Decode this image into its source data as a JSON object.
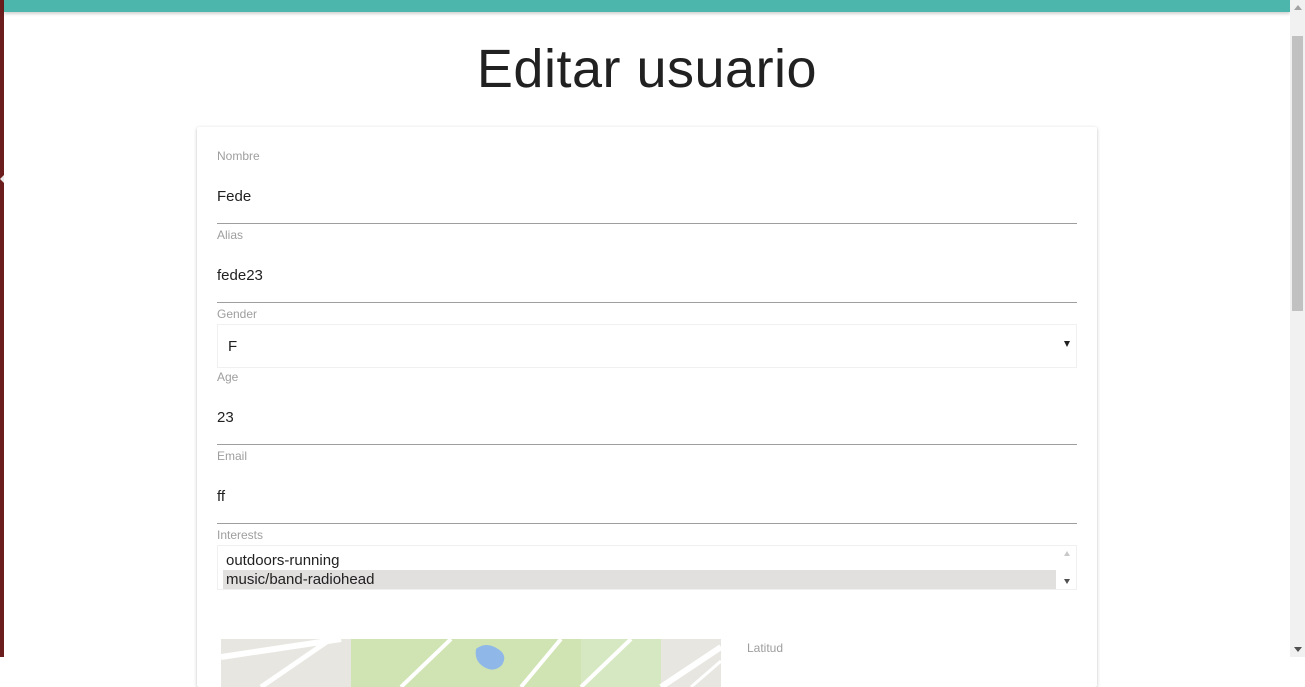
{
  "page": {
    "title": "Editar usuario"
  },
  "form": {
    "nombre": {
      "label": "Nombre",
      "value": "Fede"
    },
    "alias": {
      "label": "Alias",
      "value": "fede23"
    },
    "gender": {
      "label": "Gender",
      "selected": "F"
    },
    "age": {
      "label": "Age",
      "value": "23"
    },
    "email": {
      "label": "Email",
      "value": "ff"
    },
    "interests": {
      "label": "Interests",
      "options": [
        "outdoors-running",
        "music/band-radiohead"
      ],
      "selected": "music/band-radiohead"
    },
    "latitud": {
      "label": "Latitud"
    }
  },
  "colors": {
    "top_bar": "#4db6ac",
    "selected_option": "#e2e0df",
    "underline": "#9e9e9e"
  },
  "icons": [
    "dropdown-caret-icon",
    "scroll-up-arrow-icon",
    "scroll-down-arrow-icon"
  ]
}
